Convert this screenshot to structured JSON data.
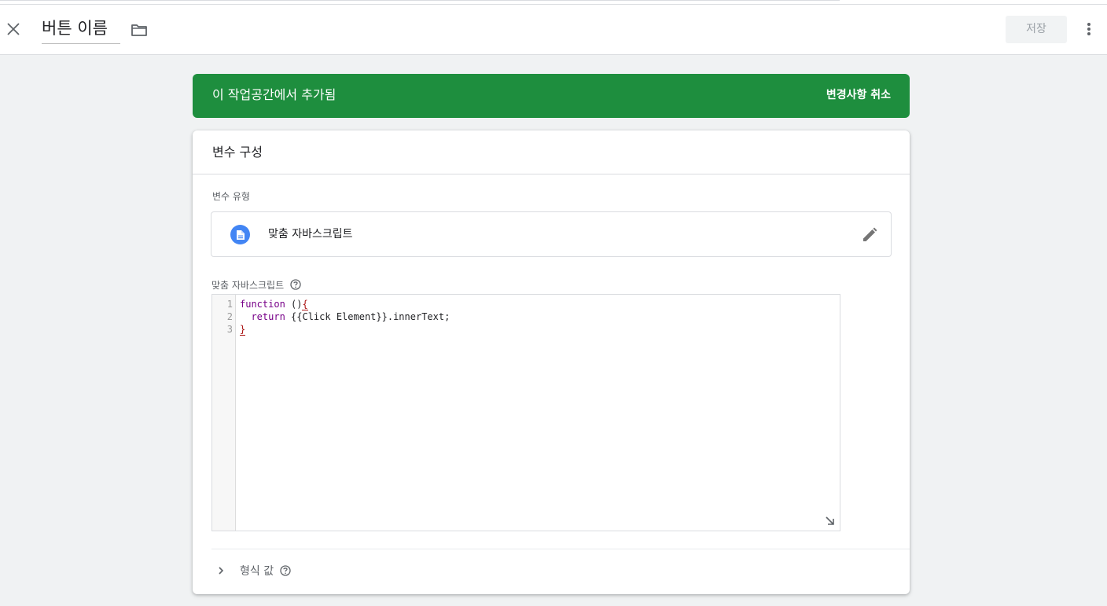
{
  "header": {
    "title": "버튼 이름",
    "save_label": "저장",
    "icons": {
      "close": "close-icon",
      "folder": "folder-icon",
      "more": "more-vert-icon"
    }
  },
  "banner": {
    "message": "이 작업공간에서 추가됨",
    "action_label": "변경사항 취소",
    "color": "#1e8e3e"
  },
  "card": {
    "title": "변수 구성",
    "type_label": "변수 유형",
    "type_name": "맞춤 자바스크립트",
    "type_icon": "document-icon",
    "edit_icon": "pencil-icon",
    "code_label": "맞춤 자바스크립트",
    "code": {
      "line_numbers": [
        "1",
        "2",
        "3"
      ],
      "line1_keyword": "function",
      "line1_rest": " ()",
      "line1_brace": "{",
      "line2_keyword": "return",
      "line2_rest": " {{Click Element}}.innerText;",
      "line3_brace": "}"
    },
    "format_label": "형식 값"
  }
}
